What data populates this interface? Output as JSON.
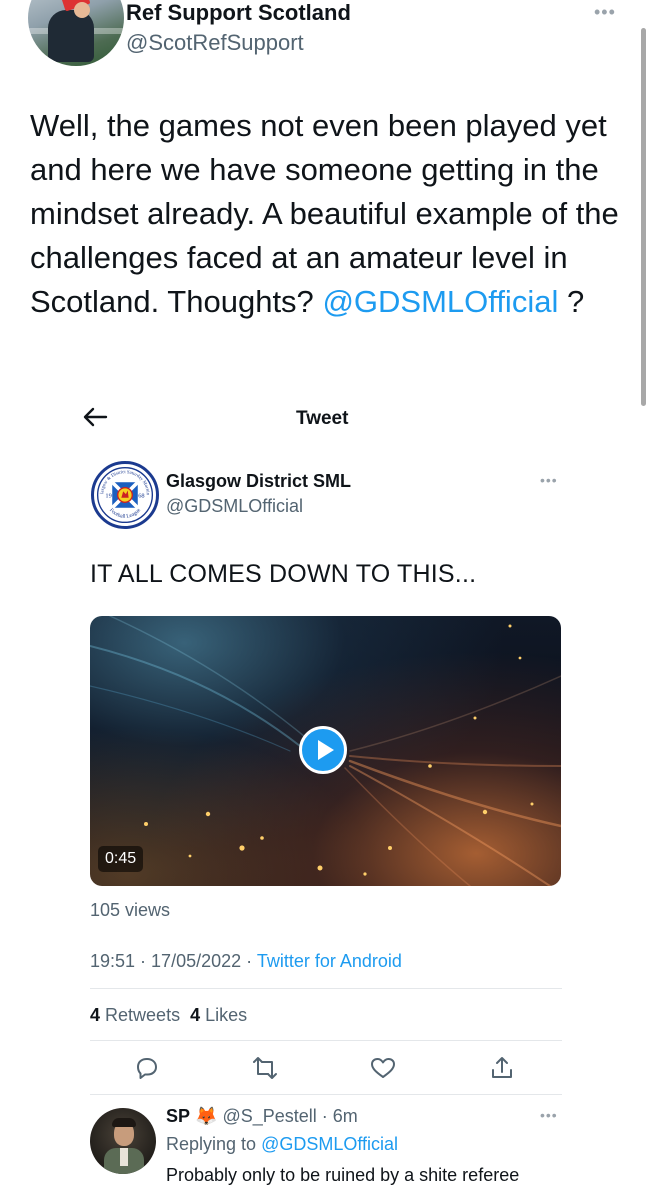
{
  "outer_tweet": {
    "name": "Ref Support Scotland",
    "handle": "@ScotRefSupport",
    "more": "•••",
    "text": "Well, the games not even been played yet and here we have someone getting in the mindset already. A beautiful example of the challenges faced at an amateur level in Scotland. Thoughts?",
    "mention": "@GDSMLOfficial",
    "trailing": " ?"
  },
  "embedded": {
    "header_title": "Tweet",
    "account": {
      "name": "Glasgow District SML",
      "handle": "@GDSMLOfficial",
      "more": "•••"
    },
    "badge": {
      "ring_text_top": "Glasgow & District Saturday Morning",
      "ring_text_bottom": "Football League",
      "year_left": "19",
      "year_right": "68"
    },
    "tweet_text": "IT ALL COMES DOWN TO THIS...",
    "video": {
      "duration": "0:45"
    },
    "views": "105 views",
    "time": "19:51",
    "date": "17/05/2022",
    "source": "Twitter for Android",
    "stats": {
      "retweets_count": "4",
      "retweets_label": "Retweets",
      "likes_count": "4",
      "likes_label": "Likes"
    },
    "actions": [
      "reply-icon",
      "retweet-icon",
      "like-icon",
      "share-icon"
    ],
    "reply": {
      "name": "SP",
      "emoji": "🦊",
      "handle": "@S_Pestell",
      "time": "6m",
      "replying_prefix": "Replying to",
      "replying_to": "@GDSMLOfficial",
      "text": "Probably only to be ruined by a shite referee",
      "more": "•••"
    }
  },
  "colors": {
    "link": "#1d9bf0",
    "text": "#0f1419",
    "secondary": "#536471",
    "badge_blue": "#1b3a8f"
  }
}
